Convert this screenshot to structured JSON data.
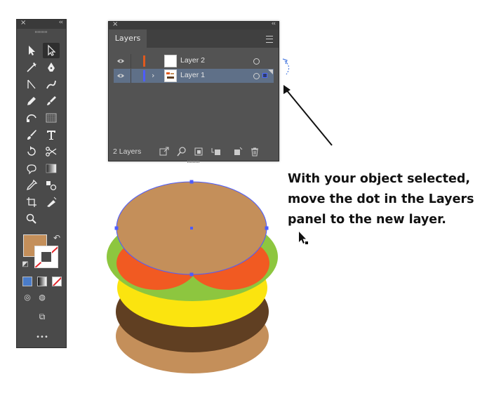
{
  "tools_panel": {
    "close_glyph": "×",
    "collapse_glyph": "‹‹",
    "fill_color": "#c48f5a",
    "stroke_slash_color": "#e3262b",
    "more_label": "•••",
    "icons": [
      "selection-tool-icon",
      "direct-selection-tool-icon",
      "magic-wand-icon",
      "pen-tool-icon",
      "curvature-tool-icon",
      "shaper-tool-icon",
      "pencil-tool-icon",
      "paintbrush-tool-icon",
      "eraser-tool-icon",
      "mesh-tool-icon",
      "brush-tool-icon",
      "type-tool-icon",
      "rotate-tool-icon",
      "scissors-tool-icon",
      "puppet-warp-icon",
      "gradient-tool-icon",
      "eyedropper-tool-icon",
      "blend-tool-icon",
      "artboard-tool-icon",
      "symbol-sprayer-icon",
      "zoom-tool-icon"
    ]
  },
  "layers_panel": {
    "tab_label": "Layers",
    "close_glyph": "×",
    "collapse_glyph": "‹‹",
    "layers": [
      {
        "name": "Layer 2",
        "color": "#e05a1e",
        "selected": false
      },
      {
        "name": "Layer 1",
        "color": "#4d5cff",
        "selected": true,
        "expand_glyph": "›"
      }
    ],
    "footer_count": "2 Layers"
  },
  "instruction_text": "With your object selected, move the dot in the Layers panel to the new layer.",
  "artwork": {
    "bun_color": "#c48f5a",
    "lettuce_color": "#8dc63f",
    "tomato_color": "#f15a22",
    "cheese_color": "#fbe40f",
    "patty_color": "#603f22",
    "selection_color": "#4d5cff"
  }
}
